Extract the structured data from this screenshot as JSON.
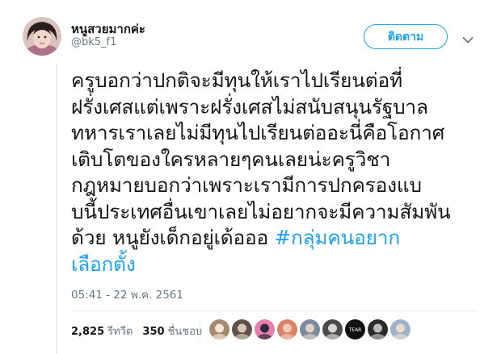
{
  "author": {
    "display_name": "หนูสวยมากค่ะ",
    "handle": "@bk5_f1"
  },
  "follow_button": {
    "label": "ติดตาม"
  },
  "tweet": {
    "lines": [
      "ครูบอกว่าปกติจะมีทุนให้เราไปเรียนต่อที่",
      "ฝรั่งเศสแต่เพราะฝรั่งเศสไม่สนับสนุนรัฐบาล",
      "ทหารเราเลยไม่มีทุนไปเรียนต่ออะนี่คือโอกาศ",
      "เติบโตของใครหลายๆคนเลยน่ะครูวิชา",
      "กฎหมายบอกว่าเพราะเรามีการปกครองแบ",
      "บนี้ประเทศอื่นเขาเลยไม่อยากจะมีความสัมพัน"
    ],
    "line7_text": "ด้วย หนูยังเด็กอยู่เด้อออ ",
    "hashtag_part1": "#กลุ่มคนอยาก",
    "hashtag_part2": "เลือกตั้ง"
  },
  "timestamp": "05:41 - 22 พ.ค. 2561",
  "stats": {
    "retweets_count": "2,825",
    "retweets_label": "รีทวีต",
    "likes_count": "350",
    "likes_label": "ชื่นชอบ"
  },
  "liker_avatars": [
    {
      "name": "liker-avatar-1",
      "color": "#a58a6d",
      "accent": "#f1e6d8"
    },
    {
      "name": "liker-avatar-2",
      "color": "#5f5249",
      "accent": "#d9c8b5"
    },
    {
      "name": "liker-avatar-3",
      "color": "#e87fa6",
      "accent": "#2e2a45"
    },
    {
      "name": "liker-avatar-4",
      "color": "#d8826a",
      "accent": "#f4c9b8"
    },
    {
      "name": "liker-avatar-5",
      "color": "#7a8aa0",
      "accent": "#e2d0c0"
    },
    {
      "name": "liker-avatar-6",
      "color": "#4a4a4a",
      "accent": "#d6d6d6"
    },
    {
      "name": "liker-avatar-7",
      "color": "#111111",
      "accent": "#ffffff",
      "text": "TEAR"
    },
    {
      "name": "liker-avatar-8",
      "color": "#2a2a2a",
      "accent": "#bbbbbb"
    },
    {
      "name": "liker-avatar-9",
      "color": "#9fb3c8",
      "accent": "#e9dccb"
    }
  ],
  "colors": {
    "accent": "#1da1f2",
    "text": "#14171a",
    "muted": "#657786",
    "border": "#e6ecf0"
  },
  "icons": {
    "caret": "chevron-down-icon"
  }
}
